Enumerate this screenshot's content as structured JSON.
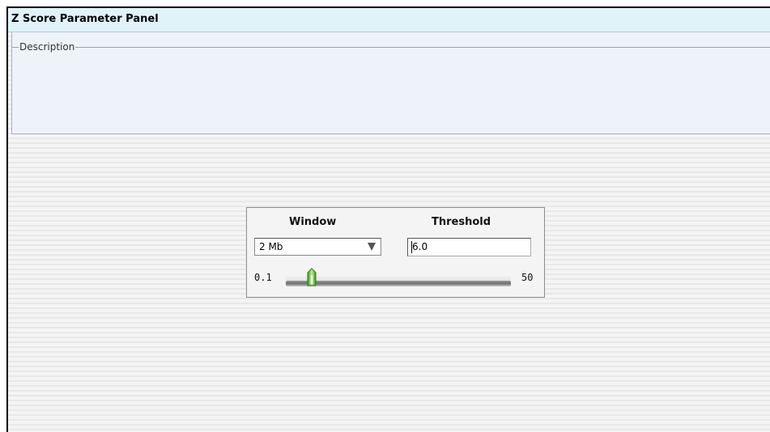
{
  "panel": {
    "title": "Z Score Parameter Panel"
  },
  "description": {
    "legend": "Description"
  },
  "parameters": {
    "window_label": "Window",
    "threshold_label": "Threshold",
    "window_select": {
      "selected": "2 Mb"
    },
    "threshold_input": {
      "value": "6.0"
    },
    "slider": {
      "min_label": "0.1",
      "max_label": "50",
      "min": 0.1,
      "max": 50,
      "value": 2
    }
  },
  "colors": {
    "title_bar": "#dff3f9",
    "description_bg": "#eef3f9",
    "slider_thumb": "#5fbf3a"
  },
  "icons": {
    "select_arrow": "chevron-down-icon",
    "slider_thumb": "slider-thumb-icon"
  }
}
